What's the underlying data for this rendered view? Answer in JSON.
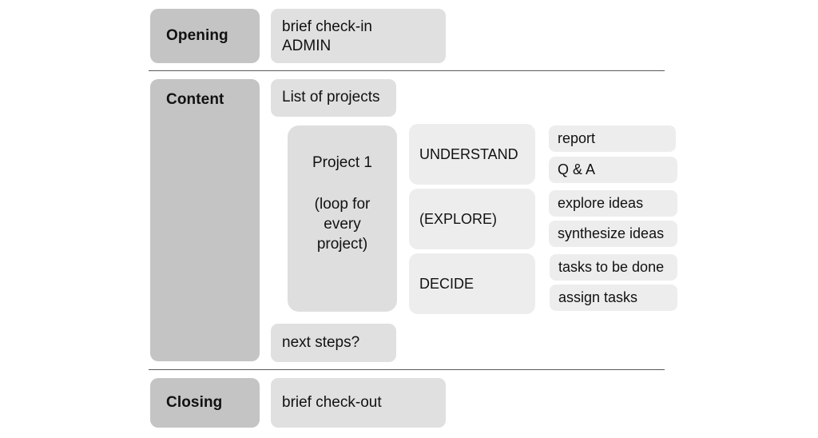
{
  "diagram": {
    "title_hidden": "",
    "colors": {
      "background": "#ffffff",
      "stage_box": "#c4c4c4",
      "card": "#e0e0e0",
      "pill": "#ededed",
      "loop_card": "#dedede",
      "divider": "#5a5a5a",
      "text": "#111111"
    },
    "rows": [
      {
        "stage": "Opening",
        "card_lines": [
          "brief check-in",
          "ADMIN"
        ]
      },
      {
        "stage": "Content"
      },
      {
        "stage": "Closing",
        "card_lines": [
          "brief check-out"
        ]
      }
    ],
    "content": {
      "list_of_projects": "List of projects",
      "next_steps": "next steps?",
      "loop": {
        "title": "Project 1",
        "subtitle_lines": [
          "(loop for",
          "every",
          "project)"
        ]
      },
      "phases": [
        {
          "label": "UNDERSTAND"
        },
        {
          "label": "(EXPLORE)"
        },
        {
          "label": "DECIDE"
        }
      ],
      "activities": [
        {
          "label": "report"
        },
        {
          "label": "Q & A"
        },
        {
          "label": "explore ideas"
        },
        {
          "label": "synthesize ideas"
        },
        {
          "label": "tasks to be done"
        },
        {
          "label": "assign tasks"
        }
      ]
    }
  }
}
